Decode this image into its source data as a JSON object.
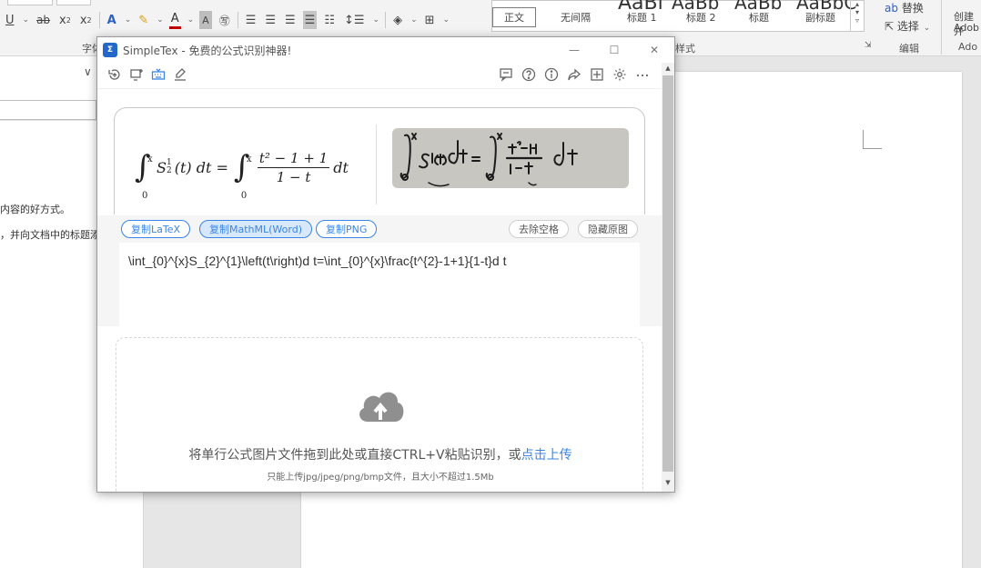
{
  "word": {
    "font_group_label": "字体",
    "styles_group_label": "样式",
    "edit_group_label": "编辑",
    "adobe_label": "Ado",
    "styles": [
      "正文",
      "无间隔",
      "标题 1",
      "标题 2",
      "标题",
      "副标题"
    ],
    "style_big": [
      "AaBl",
      "AaBb",
      "AaBb",
      "AaBbC"
    ],
    "edit_items": [
      "替换",
      "选择",
      "创建并",
      "Adob"
    ],
    "nav_text_1": "内容的好方式。",
    "nav_text_2": "，并向文档中的标题添",
    "colors": {
      "ribbon": "#f3f3f3",
      "page": "#ffffff"
    }
  },
  "simpletex": {
    "app_title": "SimpleTex - 免费的公式识别神器!",
    "logo_text": "Σ",
    "toolbar_left_icons": [
      "refresh-icon",
      "screen-capture-icon",
      "keyboard-icon",
      "handwriting-icon"
    ],
    "toolbar_right_icons": [
      "comment-icon",
      "help-icon",
      "info-icon",
      "share-icon",
      "pin-icon",
      "settings-icon",
      "more-icon"
    ],
    "formula": {
      "int1_upper": "x",
      "int1_lower": "0",
      "part1": "S",
      "part1_sub": "2",
      "part1_sup": "1",
      "part2": "(t) dt =",
      "int2_upper": "x",
      "int2_lower": "0",
      "frac_num": "t² − 1 + 1",
      "frac_den": "1 − t",
      "part3": "dt"
    },
    "buttons": {
      "copy_latex": "复制LaTeX",
      "copy_mathml": "复制MathML(Word)",
      "copy_png": "复制PNG",
      "remove_spaces": "去除空格",
      "hide_original": "隐藏原图"
    },
    "latex_output": "\\int_{0}^{x}S_{2}^{1}\\left(t\\right)d t=\\int_{0}^{x}\\frac{t^{2}-1+1}{1-t}d t",
    "upload": {
      "main_text": "将单行公式图片文件拖到此处或直接CTRL+V粘贴识别，或",
      "link_text": "点击上传",
      "hint": "只能上传jpg/jpeg/png/bmp文件，且大小不超过1.5Mb"
    },
    "colors": {
      "accent": "#3a85e6",
      "active_pill": "#d8e8fb",
      "upload_icon": "#8f8f8f"
    }
  }
}
